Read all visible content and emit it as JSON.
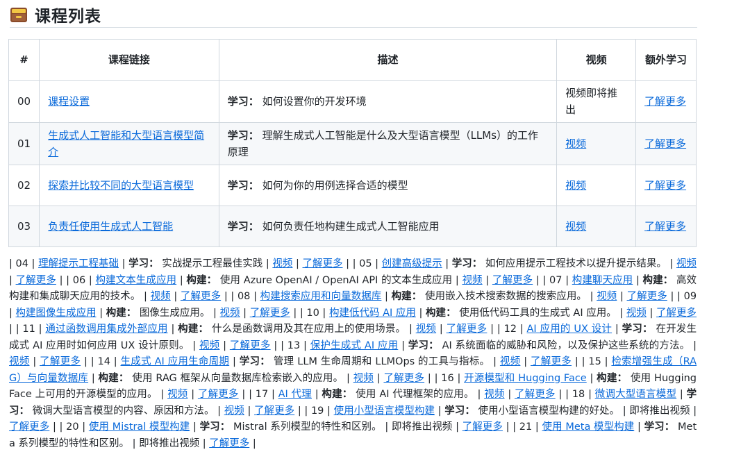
{
  "heading": {
    "icon": "card-file-box-icon",
    "title": "课程列表"
  },
  "table": {
    "headers": [
      "#",
      "课程链接",
      "描述",
      "视频",
      "额外学习"
    ],
    "rows": [
      {
        "num": "00",
        "link": "课程设置",
        "desc_label": "学习：",
        "desc": "如何设置你的开发环境",
        "video": "视频即将推出",
        "video_is_link": false,
        "extra": "了解更多"
      },
      {
        "num": "01",
        "link": "生成式人工智能和大型语言模型简介",
        "desc_label": "学习：",
        "desc": "理解生成式人工智能是什么及大型语言模型（LLMs）的工作原理",
        "video": "视频",
        "video_is_link": true,
        "extra": "了解更多"
      },
      {
        "num": "02",
        "link": "探索并比较不同的大型语言模型",
        "desc_label": "学习：",
        "desc": "如何为你的用例选择合适的模型",
        "video": "视频",
        "video_is_link": true,
        "extra": "了解更多"
      },
      {
        "num": "03",
        "link": "负责任使用生成式人工智能",
        "desc_label": "学习：",
        "desc": "如何负责任地构建生成式人工智能应用",
        "video": "视频",
        "video_is_link": true,
        "extra": "了解更多"
      }
    ]
  },
  "paragraph": {
    "items": [
      {
        "num": "04",
        "link": "理解提示工程基础",
        "label": "学习：",
        "desc": "实战提示工程最佳实践",
        "video": "视频",
        "video_is_link": true,
        "extra": "了解更多"
      },
      {
        "num": "05",
        "link": "创建高级提示",
        "label": "学习：",
        "desc": "如何应用提示工程技术以提升提示结果。",
        "video": "视频",
        "video_is_link": true,
        "extra": "了解更多"
      },
      {
        "num": "06",
        "link": "构建文本生成应用",
        "label": "构建：",
        "desc": "使用 Azure OpenAI / OpenAI API 的文本生成应用",
        "video": "视频",
        "video_is_link": true,
        "extra": "了解更多"
      },
      {
        "num": "07",
        "link": "构建聊天应用",
        "label": "构建：",
        "desc": "高效构建和集成聊天应用的技术。",
        "video": "视频",
        "video_is_link": true,
        "extra": "了解更多"
      },
      {
        "num": "08",
        "link": "构建搜索应用和向量数据库",
        "label": "构建：",
        "desc": "使用嵌入技术搜索数据的搜索应用。",
        "video": "视频",
        "video_is_link": true,
        "extra": "了解更多"
      },
      {
        "num": "09",
        "link": "构建图像生成应用",
        "label": "构建：",
        "desc": "图像生成应用。",
        "video": "视频",
        "video_is_link": true,
        "extra": "了解更多"
      },
      {
        "num": "10",
        "link": "构建低代码 AI 应用",
        "label": "构建：",
        "desc": "使用低代码工具的生成式 AI 应用。",
        "video": "视频",
        "video_is_link": true,
        "extra": "了解更多"
      },
      {
        "num": "11",
        "link": "通过函数调用集成外部应用",
        "label": "构建：",
        "desc": "什么是函数调用及其在应用上的使用场景。",
        "video": "视频",
        "video_is_link": true,
        "extra": "了解更多"
      },
      {
        "num": "12",
        "link": "AI 应用的 UX 设计",
        "label": "学习：",
        "desc": "在开发生成式 AI 应用时如何应用 UX 设计原则。",
        "video": "视频",
        "video_is_link": true,
        "extra": "了解更多"
      },
      {
        "num": "13",
        "link": "保护生成式 AI 应用",
        "label": "学习：",
        "desc": "AI 系统面临的威胁和风险，以及保护这些系统的方法。",
        "video": "视频",
        "video_is_link": true,
        "extra": "了解更多"
      },
      {
        "num": "14",
        "link": "生成式 AI 应用生命周期",
        "label": "学习：",
        "desc": "管理 LLM 生命周期和 LLMOps 的工具与指标。",
        "video": "视频",
        "video_is_link": true,
        "extra": "了解更多"
      },
      {
        "num": "15",
        "link": "检索增强生成（RAG）与向量数据库",
        "label": "构建：",
        "desc": "使用 RAG 框架从向量数据库检索嵌入的应用。",
        "video": "视频",
        "video_is_link": true,
        "extra": "了解更多"
      },
      {
        "num": "16",
        "link": "开源模型和 Hugging Face",
        "label": "构建：",
        "desc": "使用 Hugging Face 上可用的开源模型的应用。",
        "video": "视频",
        "video_is_link": true,
        "extra": "了解更多"
      },
      {
        "num": "17",
        "link": "AI 代理",
        "label": "构建：",
        "desc": "使用 AI 代理框架的应用。",
        "video": "视频",
        "video_is_link": true,
        "extra": "了解更多"
      },
      {
        "num": "18",
        "link": "微调大型语言模型",
        "label": "学习：",
        "desc": "微调大型语言模型的内容、原因和方法。",
        "video": "视频",
        "video_is_link": true,
        "extra": "了解更多"
      },
      {
        "num": "19",
        "link": "使用小型语言模型构建",
        "label": "学习：",
        "desc": "使用小型语言模型构建的好处。",
        "video": "即将推出视频",
        "video_is_link": false,
        "extra": "了解更多"
      },
      {
        "num": "20",
        "link": "使用 Mistral 模型构建",
        "label": "学习：",
        "desc": "Mistral 系列模型的特性和区别。",
        "video": "即将推出视频",
        "video_is_link": false,
        "extra": "了解更多"
      },
      {
        "num": "21",
        "link": "使用 Meta 模型构建",
        "label": "学习：",
        "desc": "Meta 系列模型的特性和区别。",
        "video": "即将推出视频",
        "video_is_link": false,
        "extra": "了解更多"
      }
    ]
  }
}
